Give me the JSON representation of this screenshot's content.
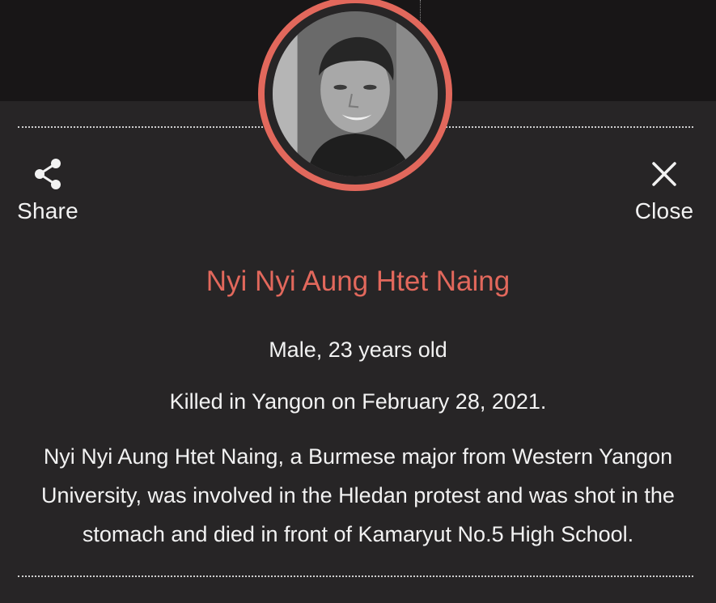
{
  "share": {
    "label": "Share",
    "icon": "share-icon"
  },
  "close": {
    "label": "Close",
    "icon": "close-icon"
  },
  "profile": {
    "name": "Nyi Nyi Aung Htet Naing",
    "gender_age": "Male, 23 years old",
    "killed": "Killed in Yangon on February 28, 2021.",
    "bio": "Nyi Nyi Aung Htet Naing, a Burmese major from Western Yangon University, was involved in the Hledan protest and was shot in the stomach and died in front of Kamaryut No.5 High School."
  },
  "colors": {
    "accent": "#e2685c",
    "background": "#272526",
    "header_band": "#181617",
    "text": "#f2f2f2"
  }
}
